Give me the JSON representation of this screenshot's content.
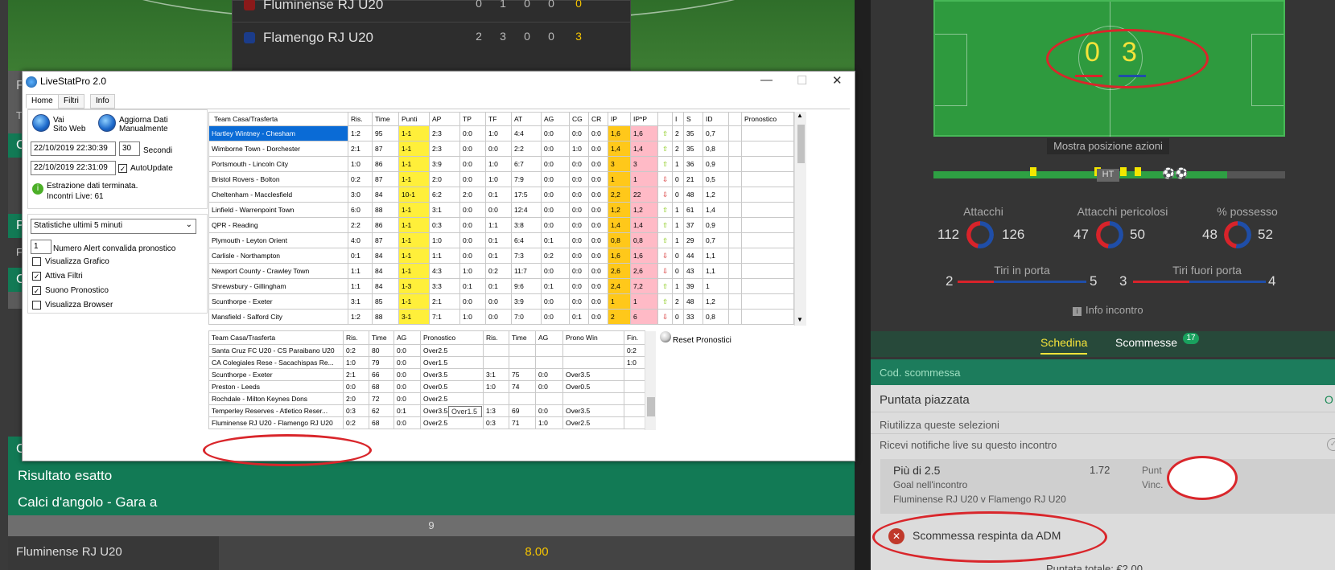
{
  "scoreboard": {
    "rows": [
      {
        "team": "Fluminense RJ U20",
        "cols": [
          "0",
          "1",
          "0",
          "0"
        ],
        "total": "0"
      },
      {
        "team": "Flamengo RJ U20",
        "cols": [
          "2",
          "3",
          "0",
          "0"
        ],
        "total": "3"
      }
    ]
  },
  "left_letters": [
    "F",
    "T",
    "C",
    "P",
    "F",
    "C",
    "C"
  ],
  "markets": [
    "Risultato esatto",
    "Calci d'angolo - Gara a"
  ],
  "bottom": {
    "number": "9",
    "team": "Fluminense RJ U20",
    "odd": "8.00"
  },
  "field": {
    "home_score": "0",
    "away_score": "3",
    "show_positions": "Mostra posizione azioni",
    "ht": "HT"
  },
  "stats": {
    "attacks": {
      "title": "Attacchi",
      "home": "112",
      "away": "126"
    },
    "dangerous": {
      "title": "Attacchi pericolosi",
      "home": "47",
      "away": "50"
    },
    "possession": {
      "title": "% possesso",
      "home": "48",
      "away": "52"
    },
    "shots_on": {
      "title": "Tiri in porta",
      "home": "2",
      "away": "5"
    },
    "shots_off": {
      "title": "Tiri fuori porta",
      "home": "3",
      "away": "4"
    },
    "info": "Info incontro"
  },
  "betslip": {
    "tab_slip": "Schedina",
    "tab_bets": "Scommesse",
    "bets_count": "17",
    "code": "Cod. scommessa",
    "placed": "Puntata piazzata",
    "placed_right": "O",
    "reuse": "Riutilizza queste selezioni",
    "notify": "Ricevi notifiche live su questo incontro",
    "selection": "Più di 2.5",
    "odd": "1.72",
    "market": "Goal nell'incontro",
    "match": "Fluminense RJ U20 v Flamengo RJ U20",
    "stake_label": "Punt",
    "win_label": "Vinc.",
    "rejected": "Scommessa respinta da ADM",
    "total": "Puntata totale: €2.00"
  },
  "app": {
    "title": "LiveStatPro 2.0",
    "tabs": [
      "Home",
      "Filtri",
      "Info"
    ],
    "visit_site": [
      "Vai",
      "Sito Web"
    ],
    "update_manual": [
      "Aggiorna Dati",
      "Manualmente"
    ],
    "datetime1": "22/10/2019 22:30:39",
    "seconds_value": "30",
    "seconds_label": "Secondi",
    "datetime2": "22/10/2019 22:31:09",
    "autoupdate": "AutoUpdate",
    "status1": "Estrazione dati terminata.",
    "status2": "Incontri Live: 61",
    "stats_select": "Statistiche ultimi 5 minuti",
    "alert_value": "1",
    "alert_label": "Numero Alert convalida pronostico",
    "opt_graph": "Visualizza Grafico",
    "opt_filters": "Attiva Filtri",
    "opt_sound": "Suono Pronostico",
    "opt_browser": "Visualizza Browser",
    "reset": "Reset Pronostici",
    "tooltip": "Over1.5"
  },
  "main_table": {
    "headers": [
      "Team Casa/Trasferta",
      "Ris.",
      "Time",
      "Punti",
      "AP",
      "TP",
      "TF",
      "AT",
      "AG",
      "CG",
      "CR",
      "IP",
      "IP*P",
      "",
      "I",
      "S",
      "ID",
      "",
      "Pronostico"
    ],
    "rows": [
      [
        "Hartley Wintney - Chesham",
        "1:2",
        "95",
        "1-1",
        "2:3",
        "0:0",
        "1:0",
        "4:4",
        "0:0",
        "0:0",
        "0:0",
        "1,6",
        "1,6",
        "up",
        "2",
        "35",
        "0,7"
      ],
      [
        "Wimborne Town - Dorchester",
        "2:1",
        "87",
        "1-1",
        "2:3",
        "0:0",
        "0:0",
        "2:2",
        "0:0",
        "1:0",
        "0:0",
        "1,4",
        "1,4",
        "up",
        "2",
        "35",
        "0,8"
      ],
      [
        "Portsmouth - Lincoln City",
        "1:0",
        "86",
        "1-1",
        "3:9",
        "0:0",
        "1:0",
        "6:7",
        "0:0",
        "0:0",
        "0:0",
        "3",
        "3",
        "up",
        "1",
        "36",
        "0,9"
      ],
      [
        "Bristol Rovers - Bolton",
        "0:2",
        "87",
        "1-1",
        "2:0",
        "0:0",
        "1:0",
        "7:9",
        "0:0",
        "0:0",
        "0:0",
        "1",
        "1",
        "dn",
        "0",
        "21",
        "0,5"
      ],
      [
        "Cheltenham - Macclesfield",
        "3:0",
        "84",
        "10-1",
        "6:2",
        "2:0",
        "0:1",
        "17:5",
        "0:0",
        "0:0",
        "0:0",
        "2,2",
        "22",
        "dn",
        "0",
        "48",
        "1,2"
      ],
      [
        "Linfield - Warrenpoint Town",
        "6:0",
        "88",
        "1-1",
        "3:1",
        "0:0",
        "0:0",
        "12:4",
        "0:0",
        "0:0",
        "0:0",
        "1,2",
        "1,2",
        "up",
        "1",
        "61",
        "1,4"
      ],
      [
        "QPR - Reading",
        "2:2",
        "86",
        "1-1",
        "0:3",
        "0:0",
        "1:1",
        "3:8",
        "0:0",
        "0:0",
        "0:0",
        "1,4",
        "1,4",
        "up",
        "1",
        "37",
        "0,9"
      ],
      [
        "Plymouth - Leyton Orient",
        "4:0",
        "87",
        "1-1",
        "1:0",
        "0:0",
        "0:1",
        "6:4",
        "0:1",
        "0:0",
        "0:0",
        "0,8",
        "0,8",
        "up",
        "1",
        "29",
        "0,7"
      ],
      [
        "Carlisle - Northampton",
        "0:1",
        "84",
        "1-1",
        "1:1",
        "0:0",
        "0:1",
        "7:3",
        "0:2",
        "0:0",
        "0:0",
        "1,6",
        "1,6",
        "dn",
        "0",
        "44",
        "1,1"
      ],
      [
        "Newport County - Crawley Town",
        "1:1",
        "84",
        "1-1",
        "4:3",
        "1:0",
        "0:2",
        "11:7",
        "0:0",
        "0:0",
        "0:0",
        "2,6",
        "2,6",
        "dn",
        "0",
        "43",
        "1,1"
      ],
      [
        "Shrewsbury - Gillingham",
        "1:1",
        "84",
        "1-3",
        "3:3",
        "0:1",
        "0:1",
        "9:6",
        "0:1",
        "0:0",
        "0:0",
        "2,4",
        "7,2",
        "up",
        "1",
        "39",
        "1"
      ],
      [
        "Scunthorpe - Exeter",
        "3:1",
        "85",
        "1-1",
        "2:1",
        "0:0",
        "0:0",
        "3:9",
        "0:0",
        "0:0",
        "0:0",
        "1",
        "1",
        "up",
        "2",
        "48",
        "1,2"
      ],
      [
        "Mansfield - Salford City",
        "1:2",
        "88",
        "3-1",
        "7:1",
        "1:0",
        "0:0",
        "7:0",
        "0:0",
        "0:1",
        "0:0",
        "2",
        "6",
        "dn",
        "0",
        "33",
        "0,8"
      ]
    ]
  },
  "prog_table": {
    "headers": [
      "Team Casa/Trasferta",
      "Ris.",
      "Time",
      "AG",
      "Pronostico",
      "Ris.",
      "Time",
      "AG",
      "Prono Win",
      "Fin."
    ],
    "rows": [
      [
        "Santa Cruz FC U20 - CS Paraibano U20",
        "0:2",
        "80",
        "0:0",
        "Over2.5",
        "",
        "",
        "",
        "",
        "0:2"
      ],
      [
        "CA Colegiales Rese - Sacachispas Re...",
        "1:0",
        "79",
        "0:0",
        "Over1.5",
        "",
        "",
        "",
        "",
        "1:0"
      ],
      [
        "Scunthorpe - Exeter",
        "2:1",
        "66",
        "0:0",
        "Over3.5",
        "3:1",
        "75",
        "0:0",
        "Over3.5",
        ""
      ],
      [
        "Preston - Leeds",
        "0:0",
        "68",
        "0:0",
        "Over0.5",
        "1:0",
        "74",
        "0:0",
        "Over0.5",
        ""
      ],
      [
        "Rochdale - Milton Keynes Dons",
        "2:0",
        "72",
        "0:0",
        "Over2.5",
        "",
        "",
        "",
        "",
        ""
      ],
      [
        "Temperley Reserves - Atletico Reser...",
        "0:3",
        "62",
        "0:1",
        "Over3.5",
        "1:3",
        "69",
        "0:0",
        "Over3.5",
        ""
      ],
      [
        "Fluminense RJ U20 - Flamengo RJ U20",
        "0:2",
        "68",
        "0:0",
        "Over2.5",
        "0:3",
        "71",
        "1:0",
        "Over2.5",
        ""
      ]
    ]
  },
  "colors": {
    "yellow": "#ffef3a",
    "orange": "#ffc81a",
    "pink": "#ffbac6",
    "accent_green": "#127a55",
    "annot_red": "#d9262b"
  }
}
